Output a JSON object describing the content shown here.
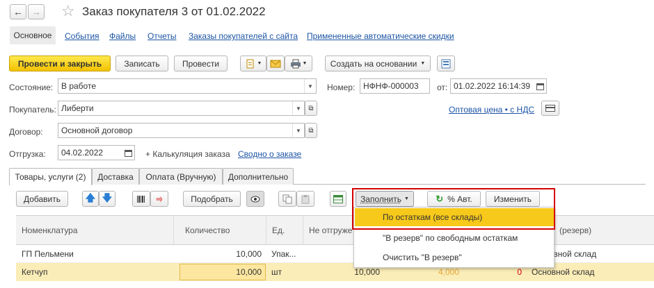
{
  "header": {
    "title": "Заказ покупателя 3 от 01.02.2022",
    "back_icon": "←",
    "forward_icon": "→",
    "star_icon": "☆"
  },
  "nav": {
    "items": [
      "Основное",
      "События",
      "Файлы",
      "Отчеты",
      "Заказы покупателей с сайта",
      "Примененные автоматические скидки"
    ]
  },
  "toolbar": {
    "post_close": "Провести и закрыть",
    "save": "Записать",
    "post": "Провести",
    "create_based": "Создать на основании"
  },
  "form": {
    "state_label": "Состояние:",
    "state_value": "В работе",
    "number_label": "Номер:",
    "number_value": "НФНФ-000003",
    "date_label": "от:",
    "date_value": "01.02.2022 16:14:39",
    "buyer_label": "Покупатель:",
    "buyer_value": "Либерти",
    "price_link": "Оптовая цена • с НДС",
    "contract_label": "Договор:",
    "contract_value": "Основной договор",
    "shipment_label": "Отгрузка:",
    "shipment_value": "04.02.2022",
    "calc_label": "+ Калькуляция заказа",
    "summary_link": "Сводно о заказе"
  },
  "tabs": [
    "Товары, услуги (2)",
    "Доставка",
    "Оплата (Вручную)",
    "Дополнительно"
  ],
  "table_toolbar": {
    "add": "Добавить",
    "pick": "Подобрать",
    "fill": "Заполнить",
    "auto_percent": "% Авт.",
    "change": "Изменить"
  },
  "fill_menu": {
    "items": [
      "По остаткам (все склады)",
      "\"В резерв\" по свободным остаткам",
      "Очистить \"В резерв\""
    ]
  },
  "table": {
    "columns": [
      "Номенклатура",
      "Количество",
      "Ед.",
      "Не отгруже",
      "(резерв)"
    ],
    "rows": [
      {
        "name": "ГП Пельмени",
        "qty": "10,000",
        "unit": "Упак...",
        "not_shipped": "",
        "reserve": "",
        "zero": "",
        "warehouse": "ОСновной склад"
      },
      {
        "name": "Кетчуп",
        "qty": "10,000",
        "unit": "шт",
        "not_shipped": "10,000",
        "reserve": "4,000",
        "zero": "0",
        "warehouse": "Основной склад"
      }
    ]
  },
  "colors": {
    "accent_yellow": "#f5c800",
    "highlight_red": "#d40000",
    "link_blue": "#1c54a4"
  }
}
